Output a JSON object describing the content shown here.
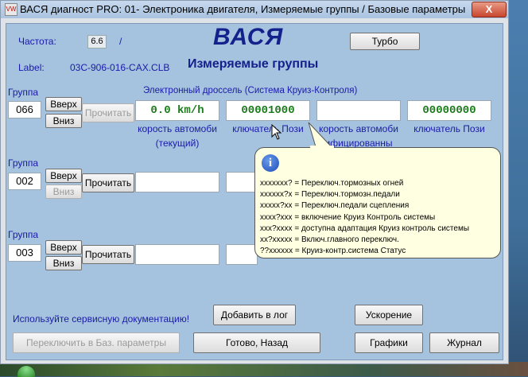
{
  "window": {
    "title": "ВАСЯ диагност PRO: 01- Электроника двигателя,  Измеряемые группы / Базовые параметры",
    "close_label": "X",
    "app_icon": "vw-icon"
  },
  "header": {
    "frequency_label": "Частота:",
    "frequency_value": "6.6",
    "frequency_sep": "/",
    "label_label": "Label:",
    "label_value": "03C-906-016-CAX.CLB",
    "brand": "ВАСЯ",
    "subtitle": "Измеряемые группы",
    "turbo_button": "Турбо"
  },
  "groups": [
    {
      "group_label": "Группа",
      "number": "066",
      "up": "Вверх",
      "down": "Вниз",
      "read": "Прочитать",
      "caption": "Электронный дроссель (Система Круиз-Контроля)",
      "fields": [
        "0.0 km/h",
        "00001000",
        "",
        "00000000"
      ],
      "headers": [
        "корость автомоби",
        "ключатель Пози",
        "корость автомоби",
        "ключатель Пози"
      ],
      "headers2": [
        "(текущий)",
        "",
        "ифицированны",
        ""
      ]
    },
    {
      "group_label": "Группа",
      "number": "002",
      "up": "Вверх",
      "down": "Вниз",
      "read": "Прочитать"
    },
    {
      "group_label": "Группа",
      "number": "003",
      "up": "Вверх",
      "down": "Вниз",
      "read": "Прочитать"
    }
  ],
  "tooltip": {
    "icon": "info-icon",
    "lines": [
      "xxxxxxx? = Переключ.тормозных огней",
      "xxxxxx?x = Переключ.тормозн.педали",
      "xxxxx?xx = Переключ.педали сцепления",
      "xxxx?xxx = включение Круиз Контроль системы",
      "xxx?xxxx = доступна адаптация Круиз контроль системы",
      "xx?xxxxx = Включ.главного переключ.",
      "??xxxxxx = Круиз-контр.система Статус"
    ]
  },
  "footer": {
    "service_doc": "Используйте сервисную документацию!",
    "add_log": "Добавить в лог",
    "acceleration": "Ускорение",
    "switch_basic": "Переключить в Баз. параметры",
    "done_back": "Готово, Назад",
    "graphics": "Графики",
    "journal": "Журнал"
  }
}
